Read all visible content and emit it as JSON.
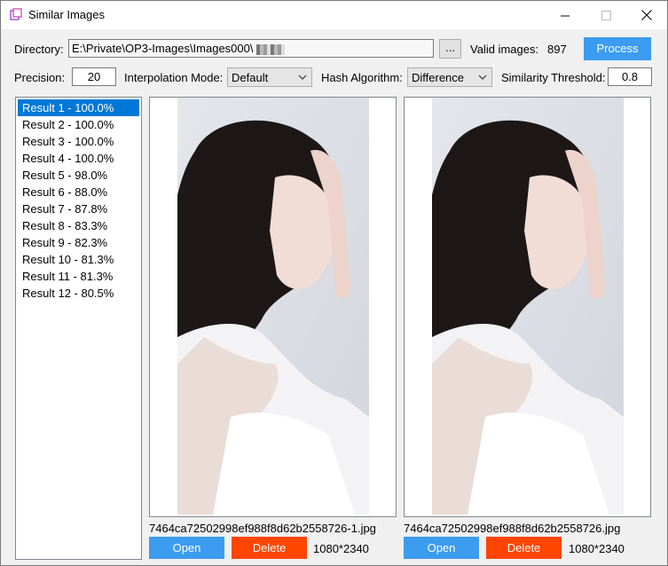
{
  "window": {
    "title": "Similar Images"
  },
  "toolbar": {
    "directory_label": "Directory:",
    "directory_value": "E:\\Private\\OP3-Images\\Images000\\",
    "browse_label": "...",
    "valid_images_label": "Valid images:",
    "valid_images_count": "897",
    "process_label": "Process",
    "precision_label": "Precision:",
    "precision_value": "20",
    "interpolation_label": "Interpolation Mode:",
    "interpolation_value": "Default",
    "hash_label": "Hash Algorithm:",
    "hash_value": "Difference",
    "threshold_label": "Similarity Threshold:",
    "threshold_value": "0.8"
  },
  "results": [
    "Result 1 - 100.0%",
    "Result 2 - 100.0%",
    "Result 3 - 100.0%",
    "Result 4 - 100.0%",
    "Result 5 - 98.0%",
    "Result 6 - 88.0%",
    "Result 7 - 87.8%",
    "Result 8 - 83.3%",
    "Result 9 - 82.3%",
    "Result 10 - 81.3%",
    "Result 11 - 81.3%",
    "Result 12 - 80.5%"
  ],
  "left_image": {
    "filename": "7464ca72502998ef988f8d62b2558726-1.jpg",
    "open_label": "Open",
    "delete_label": "Delete",
    "dimensions": "1080*2340"
  },
  "right_image": {
    "filename": "7464ca72502998ef988f8d62b2558726.jpg",
    "open_label": "Open",
    "delete_label": "Delete",
    "dimensions": "1080*2340"
  },
  "colors": {
    "accent_blue": "#3c9cf0",
    "delete_red": "#ff4500",
    "selection": "#0078d7"
  }
}
